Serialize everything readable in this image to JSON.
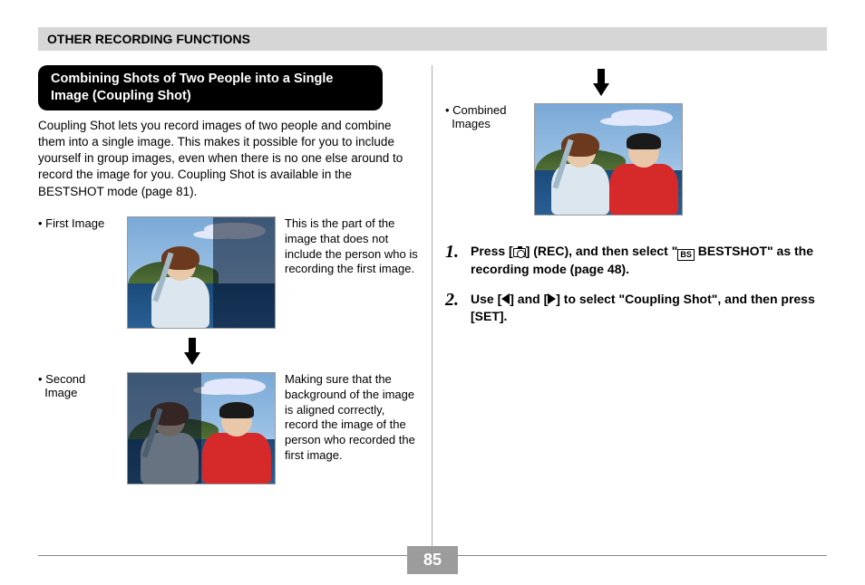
{
  "header": "OTHER RECORDING FUNCTIONS",
  "subhead": "Combining Shots of Two People into a Single Image (Coupling Shot)",
  "intro": "Coupling Shot lets you record images of two people and combine them into a single image. This makes it possible for you to include yourself in group images, even when there is no one else around to record the image for you. Coupling Shot is available in the BESTSHOT mode (page 81).",
  "first_label": "• First Image",
  "first_caption": "This is the part of the image that does not include the person who is recording the first image.",
  "second_label": "• Second\n  Image",
  "second_caption": "Making sure that the background of the image is aligned correctly, record the image of the person who recorded the first image.",
  "combined_label": "• Combined\n  Images",
  "steps": {
    "s1": {
      "num": "1.",
      "pre": "Press [",
      "mid1": "] (REC), and then select \"",
      "mid2": " BESTSHOT\" as the recording mode (page 48)."
    },
    "s2": {
      "num": "2.",
      "pre": "Use [",
      "mid1": "] and [",
      "mid2": "] to select \"Coupling Shot\", and then press [SET]."
    }
  },
  "page_number": "85"
}
